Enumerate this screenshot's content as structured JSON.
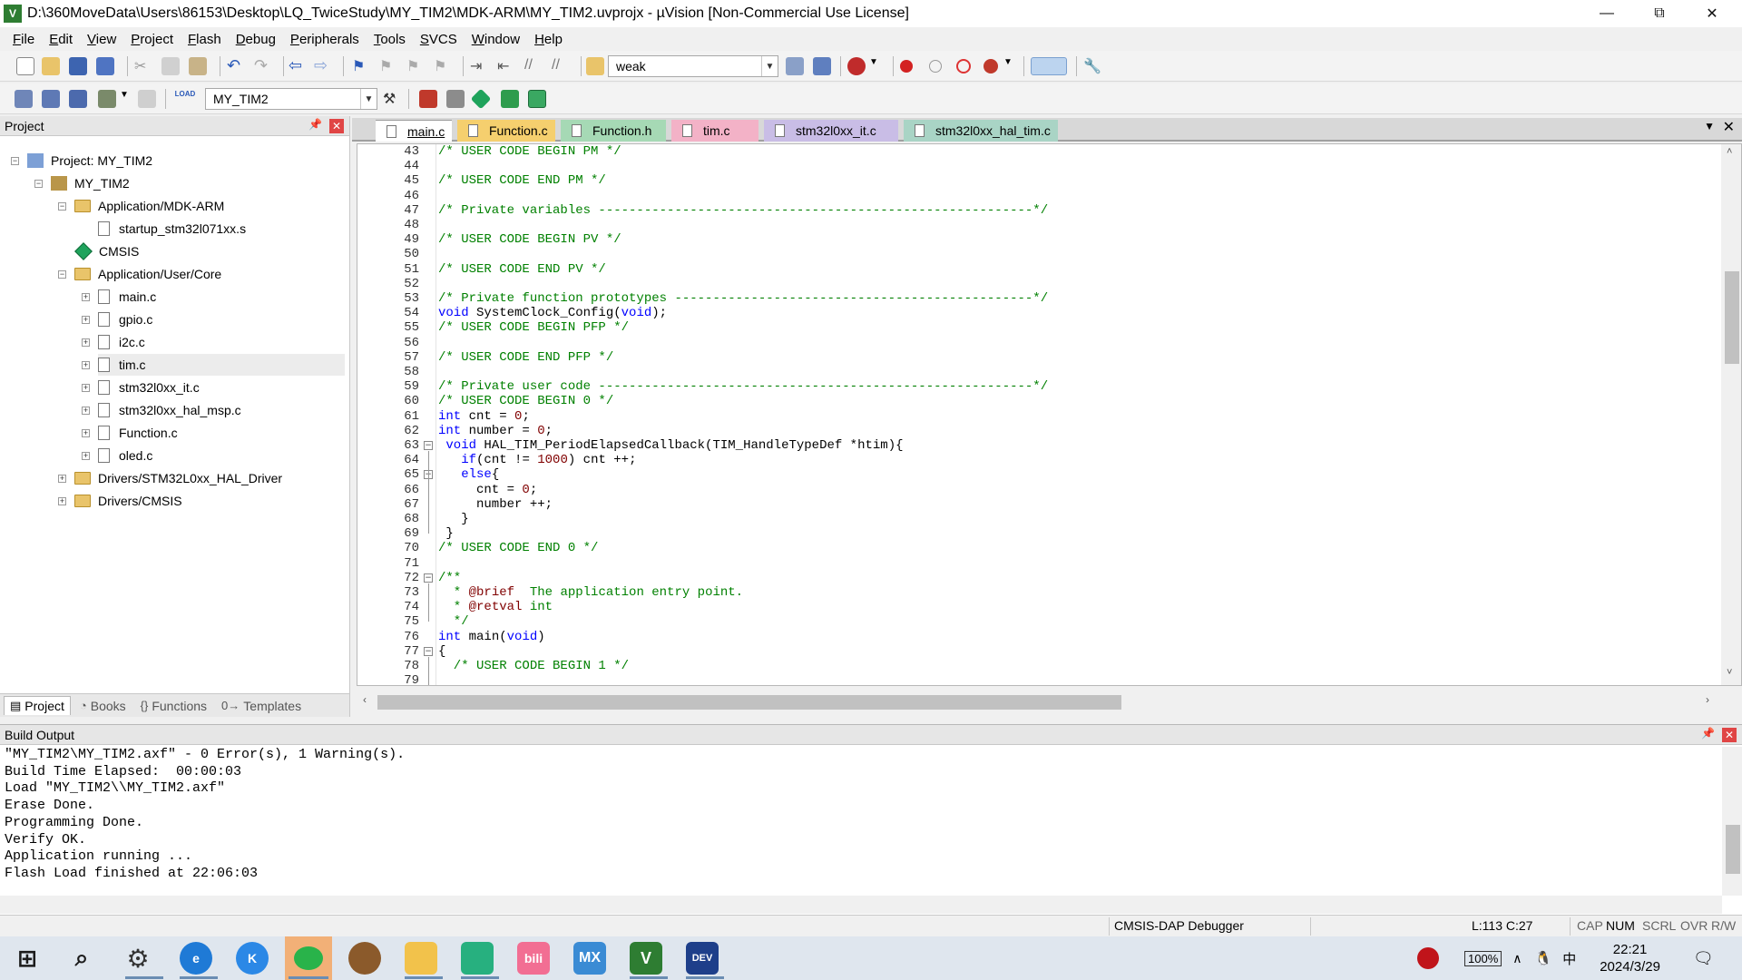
{
  "window": {
    "title": "D:\\360MoveData\\Users\\86153\\Desktop\\LQ_TwiceStudy\\MY_TIM2\\MDK-ARM\\MY_TIM2.uvprojx - µVision  [Non-Commercial Use License]",
    "app_icon": "V"
  },
  "menu": [
    "File",
    "Edit",
    "View",
    "Project",
    "Flash",
    "Debug",
    "Peripherals",
    "Tools",
    "SVCS",
    "Window",
    "Help"
  ],
  "toolbar": {
    "find_value": "weak",
    "target_value": "MY_TIM2",
    "load_label": "LOAD"
  },
  "project": {
    "panel_title": "Project",
    "tree": [
      {
        "label": "Project: MY_TIM2",
        "type": "project",
        "level": 0,
        "expander": "−"
      },
      {
        "label": "MY_TIM2",
        "type": "target",
        "level": 1,
        "expander": "−"
      },
      {
        "label": "Application/MDK-ARM",
        "type": "folder",
        "level": 2,
        "expander": "−"
      },
      {
        "label": "startup_stm32l071xx.s",
        "type": "file",
        "level": 3,
        "expander": ""
      },
      {
        "label": "CMSIS",
        "type": "cmsis",
        "level": 2,
        "expander": ""
      },
      {
        "label": "Application/User/Core",
        "type": "folder",
        "level": 2,
        "expander": "−"
      },
      {
        "label": "main.c",
        "type": "file",
        "level": 3,
        "expander": "+"
      },
      {
        "label": "gpio.c",
        "type": "file",
        "level": 3,
        "expander": "+"
      },
      {
        "label": "i2c.c",
        "type": "file",
        "level": 3,
        "expander": "+"
      },
      {
        "label": "tim.c",
        "type": "file",
        "level": 3,
        "expander": "+",
        "selected": true
      },
      {
        "label": "stm32l0xx_it.c",
        "type": "file",
        "level": 3,
        "expander": "+"
      },
      {
        "label": "stm32l0xx_hal_msp.c",
        "type": "file",
        "level": 3,
        "expander": "+"
      },
      {
        "label": "Function.c",
        "type": "file",
        "level": 3,
        "expander": "+"
      },
      {
        "label": "oled.c",
        "type": "file",
        "level": 3,
        "expander": "+"
      },
      {
        "label": "Drivers/STM32L0xx_HAL_Driver",
        "type": "folder",
        "level": 2,
        "expander": "+"
      },
      {
        "label": "Drivers/CMSIS",
        "type": "folder",
        "level": 2,
        "expander": "+"
      }
    ],
    "tabs": [
      {
        "label": "Project",
        "icon": "project-icon",
        "active": true
      },
      {
        "label": "Books",
        "icon": "books-icon"
      },
      {
        "label": "Functions",
        "icon": "functions-icon"
      },
      {
        "label": "Templates",
        "icon": "templates-icon"
      }
    ]
  },
  "editor": {
    "tabs": [
      {
        "label": "main.c",
        "color": "#ffffff",
        "active": true
      },
      {
        "label": "Function.c",
        "color": "#f5cf6e"
      },
      {
        "label": "Function.h",
        "color": "#a6d9b5"
      },
      {
        "label": "tim.c",
        "color": "#f3b2c7"
      },
      {
        "label": "stm32l0xx_it.c",
        "color": "#c9bde6"
      },
      {
        "label": "stm32l0xx_hal_tim.c",
        "color": "#a9d4c5"
      }
    ],
    "lines": [
      {
        "n": "43",
        "t": "/* USER CODE BEGIN PM */",
        "k": "comment"
      },
      {
        "n": "44",
        "t": ""
      },
      {
        "n": "45",
        "t": "/* USER CODE END PM */",
        "k": "comment"
      },
      {
        "n": "46",
        "t": ""
      },
      {
        "n": "47",
        "t": "/* Private variables ---------------------------------------------------------*/",
        "k": "comment"
      },
      {
        "n": "48",
        "t": ""
      },
      {
        "n": "49",
        "t": "/* USER CODE BEGIN PV */",
        "k": "comment"
      },
      {
        "n": "50",
        "t": ""
      },
      {
        "n": "51",
        "t": "/* USER CODE END PV */",
        "k": "comment"
      },
      {
        "n": "52",
        "t": ""
      },
      {
        "n": "53",
        "t": "/* Private function prototypes -----------------------------------------------*/",
        "k": "comment"
      },
      {
        "n": "54",
        "t": "void SystemClock_Config(void);",
        "k": "proto"
      },
      {
        "n": "55",
        "t": "/* USER CODE BEGIN PFP */",
        "k": "comment"
      },
      {
        "n": "56",
        "t": ""
      },
      {
        "n": "57",
        "t": "/* USER CODE END PFP */",
        "k": "comment"
      },
      {
        "n": "58",
        "t": ""
      },
      {
        "n": "59",
        "t": "/* Private user code ---------------------------------------------------------*/",
        "k": "comment"
      },
      {
        "n": "60",
        "t": "/* USER CODE BEGIN 0 */",
        "k": "comment"
      },
      {
        "n": "61",
        "t": "int cnt = 0;",
        "k": "decl"
      },
      {
        "n": "62",
        "t": "int number = 0;",
        "k": "decl"
      },
      {
        "n": "63",
        "t": " void HAL_TIM_PeriodElapsedCallback(TIM_HandleTypeDef *htim){",
        "k": "func",
        "fold": "−"
      },
      {
        "n": "64",
        "t": "   if(cnt != 1000) cnt ++;",
        "k": "if"
      },
      {
        "n": "65",
        "t": "   else{",
        "k": "else",
        "fold": "−"
      },
      {
        "n": "66",
        "t": "     cnt = 0;",
        "k": "assign"
      },
      {
        "n": "67",
        "t": "     number ++;",
        "k": "plain"
      },
      {
        "n": "68",
        "t": "   }",
        "k": "plain"
      },
      {
        "n": "69",
        "t": " }",
        "k": "plain"
      },
      {
        "n": "70",
        "t": "/* USER CODE END 0 */",
        "k": "comment"
      },
      {
        "n": "71",
        "t": ""
      },
      {
        "n": "72",
        "t": "/**",
        "k": "comment",
        "fold": "−"
      },
      {
        "n": "73",
        "t": "  * @brief  The application entry point.",
        "k": "doc"
      },
      {
        "n": "74",
        "t": "  * @retval int",
        "k": "doc"
      },
      {
        "n": "75",
        "t": "  */",
        "k": "comment"
      },
      {
        "n": "76",
        "t": "int main(void)",
        "k": "main"
      },
      {
        "n": "77",
        "t": "{",
        "k": "plain",
        "fold": "−"
      },
      {
        "n": "78",
        "t": "  /* USER CODE BEGIN 1 */",
        "k": "comment"
      },
      {
        "n": "79",
        "t": ""
      }
    ]
  },
  "build_output": {
    "title": "Build Output",
    "lines": [
      "\"MY_TIM2\\MY_TIM2.axf\" - 0 Error(s), 1 Warning(s).",
      "Build Time Elapsed:  00:00:03",
      "Load \"MY_TIM2\\\\MY_TIM2.axf\"",
      "Erase Done.",
      "Programming Done.",
      "Verify OK.",
      "Application running ...",
      "Flash Load finished at 22:06:03"
    ]
  },
  "status": {
    "debugger": "CMSIS-DAP Debugger",
    "position": "L:113 C:27",
    "cap": "CAP",
    "num": "NUM",
    "scrl": "SCRL",
    "ovr": "OVR",
    "rw": "R/W"
  },
  "taskbar": {
    "battery": "100%",
    "ime": "中",
    "time": "22:21",
    "date": "2024/3/29"
  }
}
